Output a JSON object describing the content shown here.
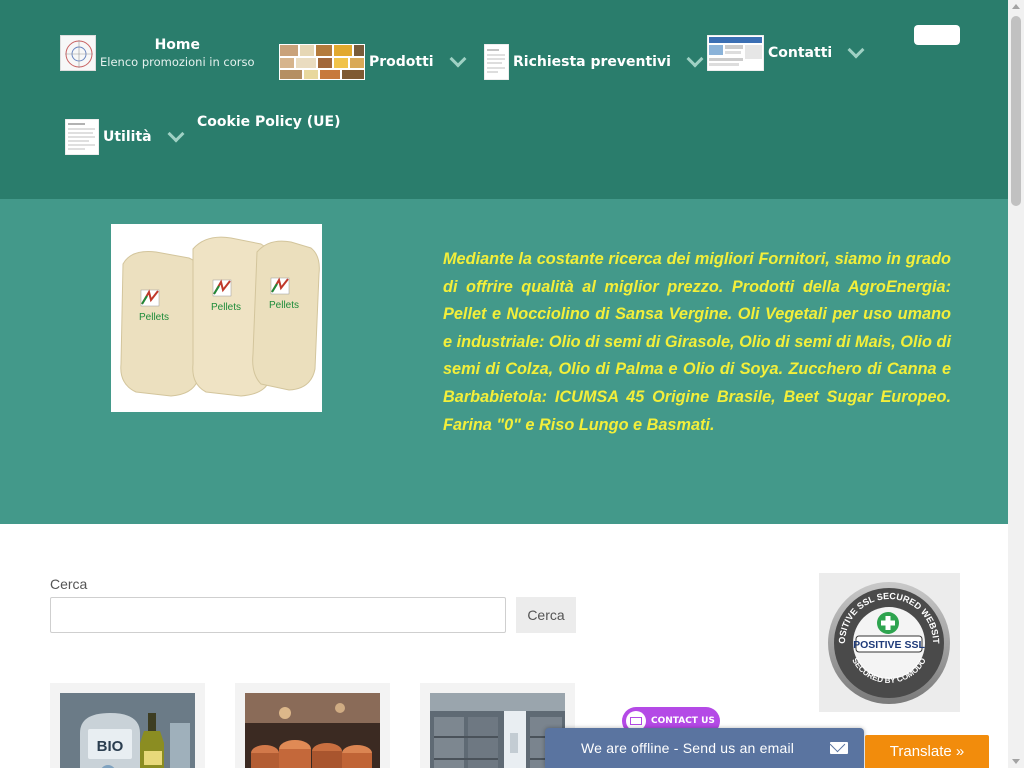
{
  "nav": {
    "home_label": "Home",
    "home_sub": "Elenco promozioni in corso",
    "prodotti": "Prodotti",
    "preventivi": "Richiesta preventivi",
    "contatti": "Contatti",
    "utilita": "Utilità",
    "cookie": "Cookie Policy (UE)"
  },
  "hero": {
    "description": "Mediante la costante ricerca dei migliori Fornitori, siamo in grado di offrire qualità al miglior prezzo. Prodotti della AgroEnergia: Pellet e Nocciolino di Sansa Vergine. Oli Vegetali per uso umano e industriale: Olio di semi di Girasole, Olio di semi di Mais, Olio di semi di Colza, Olio di Palma e Olio di Soya. Zucchero di Canna e Barbabietola: ICUMSA 45 Origine Brasile, Beet Sugar Europeo. Farina \"0\" e Riso Lungo e Basmati.",
    "pellet_bag_label": "Pellets"
  },
  "search": {
    "label": "Cerca",
    "value": "",
    "button": "Cerca"
  },
  "ssl_badge": {
    "ring_text": "POSITIVE SSL SECURED WEBSITE",
    "center": "POSITIVE SSL",
    "bottom": "SECURED BY COMODO"
  },
  "cards": [
    {
      "icon": "bio-oil-image",
      "text": "BIO"
    },
    {
      "icon": "copper-image",
      "text": ""
    },
    {
      "icon": "warehouse-image",
      "text": ""
    }
  ],
  "widgets": {
    "contact_us": "CONTACT US",
    "offline": "We are offline - Send us an email",
    "translate": "Translate »"
  },
  "colors": {
    "header_bg": "#2a7d6c",
    "hero_bg": "#43998a",
    "hero_text": "#f3ef3a",
    "translate_bg": "#f28c0c",
    "offline_bg": "#5a74a0",
    "contact_bg": "#b44ae6"
  }
}
